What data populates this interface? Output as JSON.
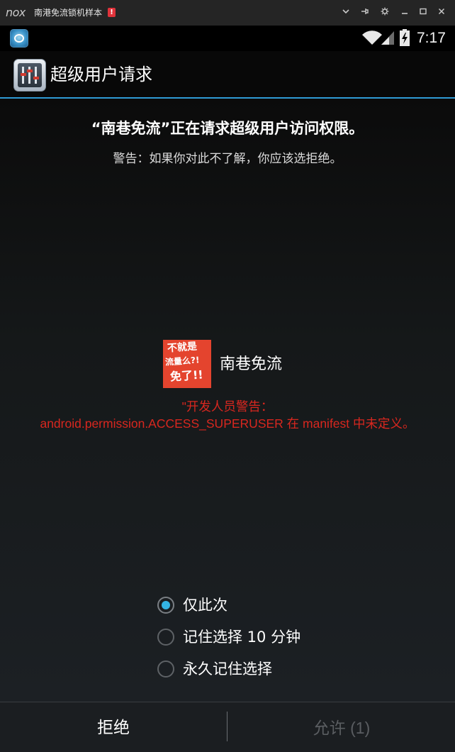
{
  "emulator": {
    "logo_text": "nox",
    "window_title": "南港免流锁机样本",
    "alert_badge": "!"
  },
  "status_bar": {
    "time": "7:17"
  },
  "dialog": {
    "title": "超级用户请求",
    "request_text": "“南巷免流”正在请求超级用户访问权限。",
    "warning_text": "警告：如果你对此不了解，你应该选拒绝。",
    "app": {
      "name": "南巷免流",
      "logo_lines": [
        "不就是",
        "流量么?!",
        "免了!!"
      ]
    },
    "developer_warning": {
      "line1": "\"开发人员警告：",
      "line2": "android.permission.ACCESS_SUPERUSER 在 manifest 中未定义。"
    },
    "options": [
      {
        "label": "仅此次",
        "checked": true
      },
      {
        "label": "记住选择 10 分钟",
        "checked": false
      },
      {
        "label": "永久记住选择",
        "checked": false
      }
    ],
    "buttons": {
      "deny": "拒绝",
      "allow": "允许 (1)"
    }
  },
  "colors": {
    "accent": "#33b5e5",
    "title_divider": "#2f9ad4",
    "dev_warning": "#d8271f",
    "logo_bg": "#e4442e",
    "disabled_text": "#5a5d61"
  }
}
